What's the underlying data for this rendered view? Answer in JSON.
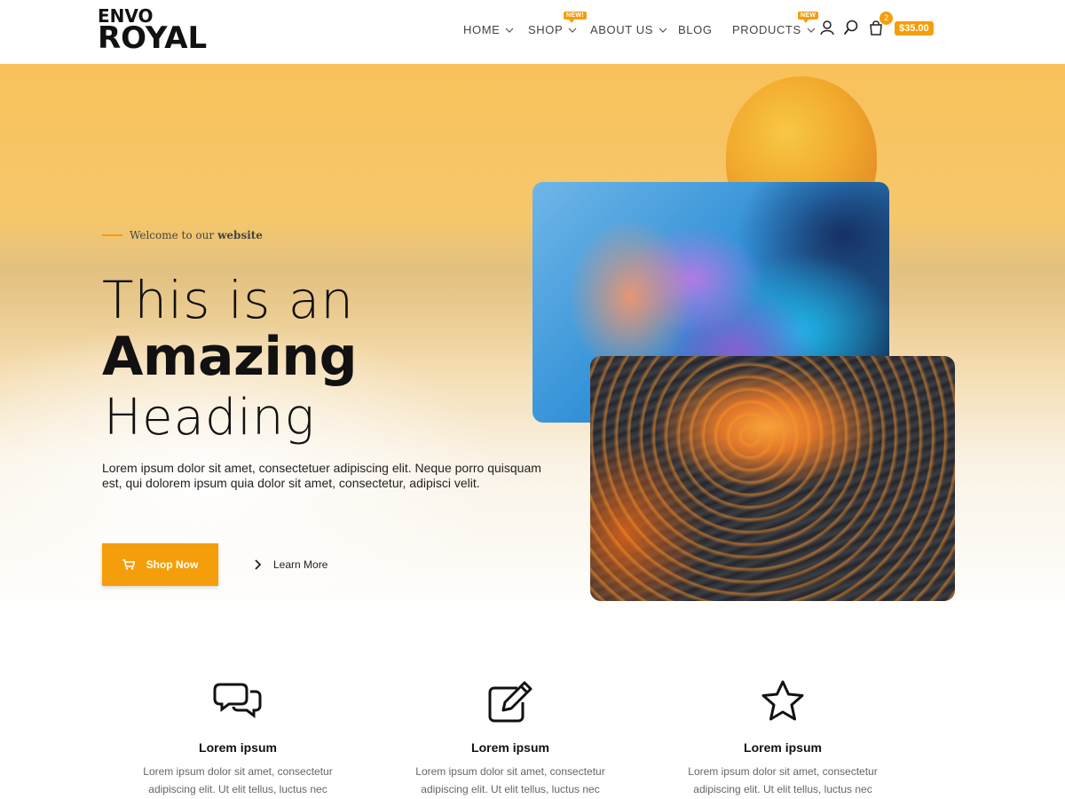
{
  "logo": {
    "line1": "ENVO",
    "line2": "ROYAL"
  },
  "nav": {
    "items": [
      {
        "label": "HOME"
      },
      {
        "label": "SHOP",
        "badge": "NEW!"
      },
      {
        "label": "ABOUT US"
      },
      {
        "label": "BLOG"
      },
      {
        "label": "PRODUCTS",
        "badge": "NEW"
      }
    ],
    "icons": [
      "user-icon",
      "search-icon",
      "cart-icon"
    ]
  },
  "cart": {
    "count": "2",
    "total": "$35.00"
  },
  "hero": {
    "tagline_prefix": "Welcome to our",
    "tagline_bold": "website",
    "heading_line1": "This is an",
    "heading_line2": "Amazing",
    "heading_line3": "Heading",
    "description": "Lorem ipsum dolor sit amet, consectetuer adipiscing elit. Neque porro quisquam est, qui dolorem ipsum quia dolor sit amet, consectetur, adipisci velit.",
    "primary_button": "Shop Now",
    "secondary_button": "Learn More"
  },
  "features": [
    {
      "icon": "chat-bubbles-icon",
      "title": "Lorem ipsum",
      "text": "Lorem ipsum dolor sit amet, consectetur adipiscing elit. Ut elit tellus, luctus nec"
    },
    {
      "icon": "edit-icon",
      "title": "Lorem ipsum",
      "text": "Lorem ipsum dolor sit amet, consectetur adipiscing elit. Ut elit tellus, luctus nec"
    },
    {
      "icon": "star-icon",
      "title": "Lorem ipsum",
      "text": "Lorem ipsum dolor sit amet, consectetur adipiscing elit. Ut elit tellus, luctus nec"
    }
  ],
  "colors": {
    "accent": "#f59e0b",
    "text": "#111111"
  }
}
